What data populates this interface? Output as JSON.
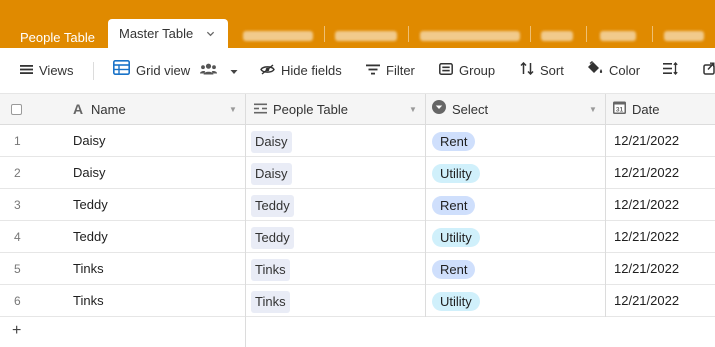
{
  "tabs": {
    "people": "People Table",
    "master": "Master Table"
  },
  "toolbar": {
    "views": "Views",
    "grid_view": "Grid view",
    "hide_fields": "Hide fields",
    "filter": "Filter",
    "group": "Group",
    "sort": "Sort",
    "color": "Color"
  },
  "columns": {
    "name": "Name",
    "people_table": "People Table",
    "select": "Select",
    "date": "Date"
  },
  "colors": {
    "brand": "#e08a00",
    "rent_pill": "#cfdffc",
    "utility_pill": "#d0f0fb",
    "link_chip": "#e9ecf6"
  },
  "rows": [
    {
      "num": "1",
      "name": "Daisy",
      "person": "Daisy",
      "select": "Rent",
      "date": "12/21/2022"
    },
    {
      "num": "2",
      "name": "Daisy",
      "person": "Daisy",
      "select": "Utility",
      "date": "12/21/2022"
    },
    {
      "num": "3",
      "name": "Teddy",
      "person": "Teddy",
      "select": "Rent",
      "date": "12/21/2022"
    },
    {
      "num": "4",
      "name": "Teddy",
      "person": "Teddy",
      "select": "Utility",
      "date": "12/21/2022"
    },
    {
      "num": "5",
      "name": "Tinks",
      "person": "Tinks",
      "select": "Rent",
      "date": "12/21/2022"
    },
    {
      "num": "6",
      "name": "Tinks",
      "person": "Tinks",
      "select": "Utility",
      "date": "12/21/2022"
    }
  ],
  "add_row": "+"
}
